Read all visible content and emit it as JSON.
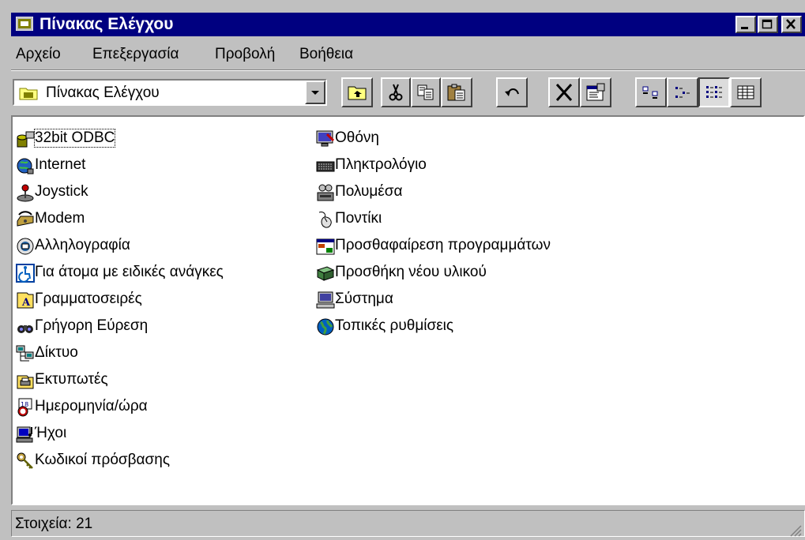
{
  "window": {
    "title": "Πίνακας Ελέγχου"
  },
  "menu": [
    "Αρχείο",
    "Επεξεργασία",
    "Προβολή",
    "Βοήθεια"
  ],
  "address": {
    "value": "Πίνακας Ελέγχου"
  },
  "toolbar": [
    "up-folder",
    "cut",
    "copy",
    "paste",
    "undo",
    "delete",
    "properties",
    "large-icons",
    "small-icons",
    "list",
    "details"
  ],
  "items": [
    {
      "label": "32bit ODBC",
      "icon": "odbc-icon",
      "color": "#808000"
    },
    {
      "label": "Internet",
      "icon": "internet-icon",
      "color": "#0000a0"
    },
    {
      "label": "Joystick",
      "icon": "joystick-icon",
      "color": "#606060"
    },
    {
      "label": "Modem",
      "icon": "modem-icon",
      "color": "#a08000"
    },
    {
      "label": "Αλληλογραφία",
      "icon": "mail-icon",
      "color": "#006080"
    },
    {
      "label": "Για άτομα με ειδικές ανάγκες",
      "icon": "accessibility-icon",
      "color": "#0060c0"
    },
    {
      "label": "Γραμματοσειρές",
      "icon": "fonts-icon",
      "color": "#c0a000"
    },
    {
      "label": "Γρήγορη Εύρεση",
      "icon": "find-icon",
      "color": "#202020"
    },
    {
      "label": "Δίκτυο",
      "icon": "network-icon",
      "color": "#006060"
    },
    {
      "label": "Εκτυπωτές",
      "icon": "printers-icon",
      "color": "#c0a000"
    },
    {
      "label": "Ημερομηνία/ώρα",
      "icon": "datetime-icon",
      "color": "#c00000"
    },
    {
      "label": "Ήχοι",
      "icon": "sounds-icon",
      "color": "#0000c0"
    },
    {
      "label": "Κωδικοί πρόσβασης",
      "icon": "passwords-icon",
      "color": "#808000"
    },
    {
      "label": "Οθόνη",
      "icon": "display-icon",
      "color": "#4040c0"
    },
    {
      "label": "Πληκτρολόγιο",
      "icon": "keyboard-icon",
      "color": "#303030"
    },
    {
      "label": "Πολυμέσα",
      "icon": "multimedia-icon",
      "color": "#505050"
    },
    {
      "label": "Ποντίκι",
      "icon": "mouse-icon",
      "color": "#707070"
    },
    {
      "label": "Προσθαφαίρεση προγραμμάτων",
      "icon": "add-remove-programs-icon",
      "color": "#c04000"
    },
    {
      "label": "Προσθήκη νέου υλικού",
      "icon": "add-hardware-icon",
      "color": "#408040"
    },
    {
      "label": "Σύστημα",
      "icon": "system-icon",
      "color": "#4040a0"
    },
    {
      "label": "Τοπικές ρυθμίσεις",
      "icon": "regional-settings-icon",
      "color": "#0060c0"
    }
  ],
  "status": {
    "text": "Στοιχεία: 21"
  }
}
